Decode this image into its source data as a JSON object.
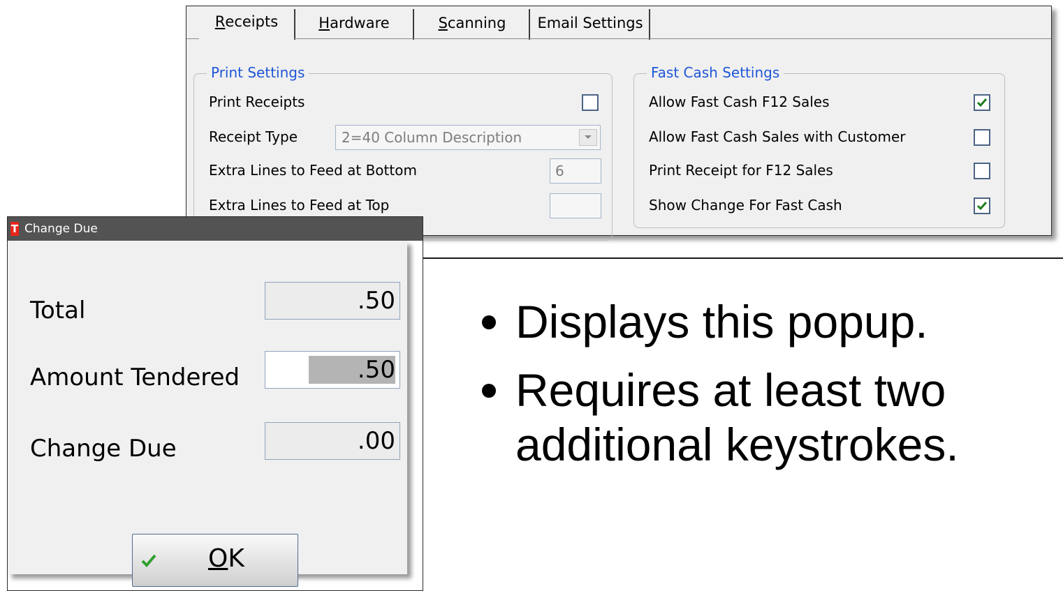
{
  "settings": {
    "tabs": [
      {
        "label": "Receipts",
        "mnemonic": "R",
        "rest": "eceipts",
        "active": true
      },
      {
        "label": "Hardware",
        "mnemonic": "H",
        "rest": "ardware",
        "active": false
      },
      {
        "label": "Scanning",
        "mnemonic": "S",
        "rest": "canning",
        "active": false
      },
      {
        "label": "Email Settings",
        "mnemonic": "",
        "rest": "Email Settings",
        "active": false
      }
    ],
    "print_settings": {
      "title": "Print Settings",
      "print_receipts_label": "Print Receipts",
      "print_receipts_checked": false,
      "receipt_type_label": "Receipt Type",
      "receipt_type_value": "2=40 Column Description",
      "extra_bottom_label": "Extra Lines to Feed at Bottom",
      "extra_bottom_value": "6",
      "extra_top_label": "Extra Lines to Feed at Top",
      "extra_top_value": ""
    },
    "fast_cash": {
      "title": "Fast Cash Settings",
      "items": [
        {
          "label": "Allow Fast Cash F12 Sales",
          "checked": true
        },
        {
          "label": "Allow Fast Cash Sales with Customer",
          "checked": false
        },
        {
          "label": "Print Receipt for F12 Sales",
          "checked": false
        },
        {
          "label": "Show Change For Fast Cash",
          "checked": true
        }
      ]
    }
  },
  "dialog": {
    "title": "Change Due",
    "icon_letter": "T",
    "total_label": "Total",
    "total_value": ".50",
    "tendered_label": "Amount Tendered",
    "tendered_value": ".50",
    "change_label": "Change Due",
    "change_value": ".00",
    "ok_mnemonic": "O",
    "ok_rest": "K",
    "ok_label": "OK"
  },
  "bullets": [
    "Displays this popup.",
    "Requires at least two additional keystrokes."
  ],
  "colors": {
    "group_title": "#1f56d6",
    "checkbox_border": "#4a6485",
    "check_mark": "#1e7b1e",
    "ok_check": "#2ea02e",
    "dialog_titlebar": "#535353",
    "app_icon": "#e8261b"
  }
}
